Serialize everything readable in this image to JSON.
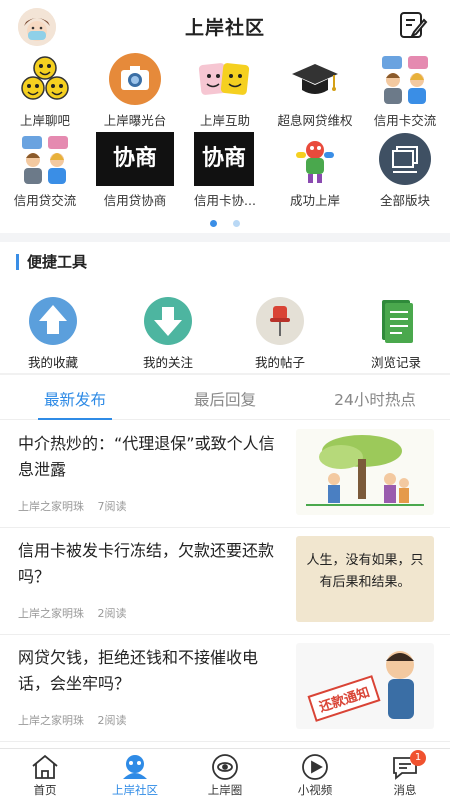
{
  "header": {
    "title": "上岸社区"
  },
  "categories": [
    {
      "label": "上岸聊吧",
      "icon": "emoji-group-icon"
    },
    {
      "label": "上岸曝光台",
      "icon": "camera-icon"
    },
    {
      "label": "上岸互助",
      "icon": "faces-icon"
    },
    {
      "label": "超息网贷维权",
      "icon": "graduation-cap-icon"
    },
    {
      "label": "信用卡交流",
      "icon": "chat-people-icon"
    },
    {
      "label": "信用贷交流",
      "icon": "chat-people-icon"
    },
    {
      "label": "信用贷协商",
      "icon_text": "协商",
      "icon": "negotiate-icon"
    },
    {
      "label": "信用卡协...",
      "icon_text": "协商",
      "icon": "negotiate-icon"
    },
    {
      "label": "成功上岸",
      "icon": "celebrate-icon"
    },
    {
      "label": "全部版块",
      "icon": "all-sections-icon"
    }
  ],
  "pager": {
    "active_color": "#3a8ee6",
    "inactive_color": "#b9d8f5"
  },
  "tools": {
    "title": "便捷工具",
    "items": [
      {
        "label": "我的收藏",
        "icon": "arrow-up-icon",
        "color": "#5b9fdc"
      },
      {
        "label": "我的关注",
        "icon": "arrow-down-icon",
        "color": "#4db5a0"
      },
      {
        "label": "我的帖子",
        "icon": "pin-icon",
        "color": "#e4e0d6"
      },
      {
        "label": "浏览记录",
        "icon": "document-icon",
        "color": "#4aa84d"
      }
    ]
  },
  "tabs": [
    "最新发布",
    "最后回复",
    "24小时热点"
  ],
  "posts": [
    {
      "title": "中介热炒的：“代理退保”或致个人信息泄露",
      "author": "上岸之家明珠",
      "reads": "7阅读"
    },
    {
      "title": "信用卡被发卡行冻结，欠款还要还款吗？",
      "author": "上岸之家明珠",
      "reads": "2阅读",
      "thumb_text": "人生，没有如果，只有后果和结果。"
    },
    {
      "title": "网贷欠钱，拒绝还钱和不接催收电话，会坐牢吗？",
      "author": "上岸之家明珠",
      "reads": "2阅读",
      "thumb_text": "还款通知"
    }
  ],
  "bottom_nav": [
    {
      "label": "首页",
      "icon": "home-icon"
    },
    {
      "label": "上岸社区",
      "icon": "community-icon",
      "active": true
    },
    {
      "label": "上岸圈",
      "icon": "circle-icon"
    },
    {
      "label": "小视频",
      "icon": "video-icon"
    },
    {
      "label": "消息",
      "icon": "message-icon",
      "badge": "1"
    }
  ],
  "colors": {
    "accent": "#2f8be6",
    "badge": "#f0522f"
  }
}
